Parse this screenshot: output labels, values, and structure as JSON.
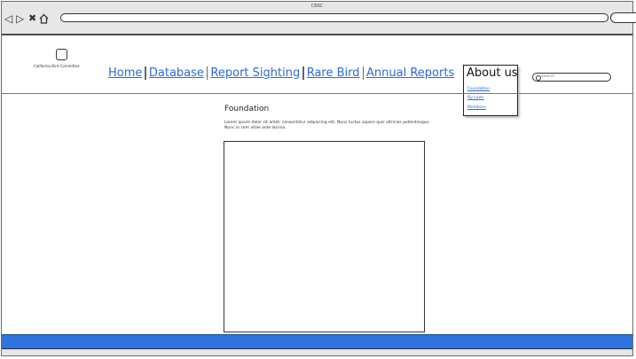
{
  "browser": {
    "title": "CBRC",
    "icons": [
      "back-icon",
      "forward-icon",
      "close-icon",
      "home-icon"
    ]
  },
  "site": {
    "logo_text": "California Bird Committee",
    "nav": [
      "Home",
      "Database",
      "Report Sighting",
      "Rare Bird",
      "Annual Reports"
    ],
    "about": {
      "title": "About us",
      "items": [
        "Foundation",
        "By-Laws",
        "Members"
      ]
    },
    "search_placeholder": "search"
  },
  "content": {
    "title": "Foundation",
    "body": "Lorem ipsum dolor sit amet, consectetur adipiscing elit. Nunc luctus sapien quis ultricies pellentesque. Nunc in sem vitae ante lacinia."
  },
  "colors": {
    "link": "#2b6bd4",
    "footer": "#2e74de",
    "chrome": "#e7e7e7"
  }
}
